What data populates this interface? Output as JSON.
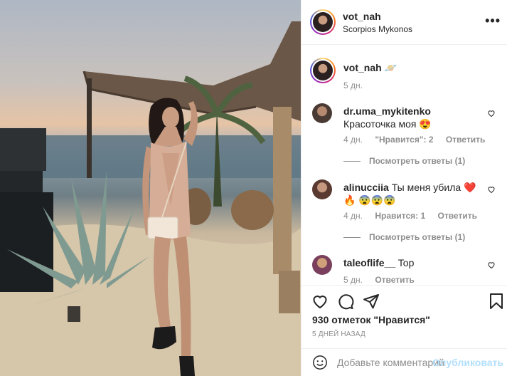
{
  "post": {
    "username": "vot_nah",
    "location": "Scorpios Mykonos",
    "more_icon": "ellipsis-icon"
  },
  "caption": {
    "username": "vot_nah",
    "text": "🪐",
    "time": "5 дн."
  },
  "comments": [
    {
      "username": "dr.uma_mykitenko",
      "text": "Красоточка моя 😍",
      "time": "4 дн.",
      "likes": "\"Нравится\": 2",
      "reply": "Ответить",
      "view_replies": "Посмотреть ответы (1)"
    },
    {
      "username": "alinucciia",
      "text": "Ты меня убила ❤️🔥 😨😨😨",
      "time": "4 дн.",
      "likes": "Нравится: 1",
      "reply": "Ответить",
      "view_replies": "Посмотреть ответы (1)"
    },
    {
      "username": "taleoflife__",
      "text": "Top",
      "time": "5 дн.",
      "reply": "Ответить"
    }
  ],
  "actions": {
    "likes_text": "930 отметок \"Нравится\"",
    "date": "5 ДНЕЙ НАЗАД"
  },
  "add_comment": {
    "placeholder": "Добавьте комментарий...",
    "post_label": "Опубликовать"
  },
  "colors": {
    "link_disabled": "#b2dffc",
    "secondary_text": "#8e8e8e",
    "primary_text": "#262626",
    "heart_red": "#ed4956"
  }
}
